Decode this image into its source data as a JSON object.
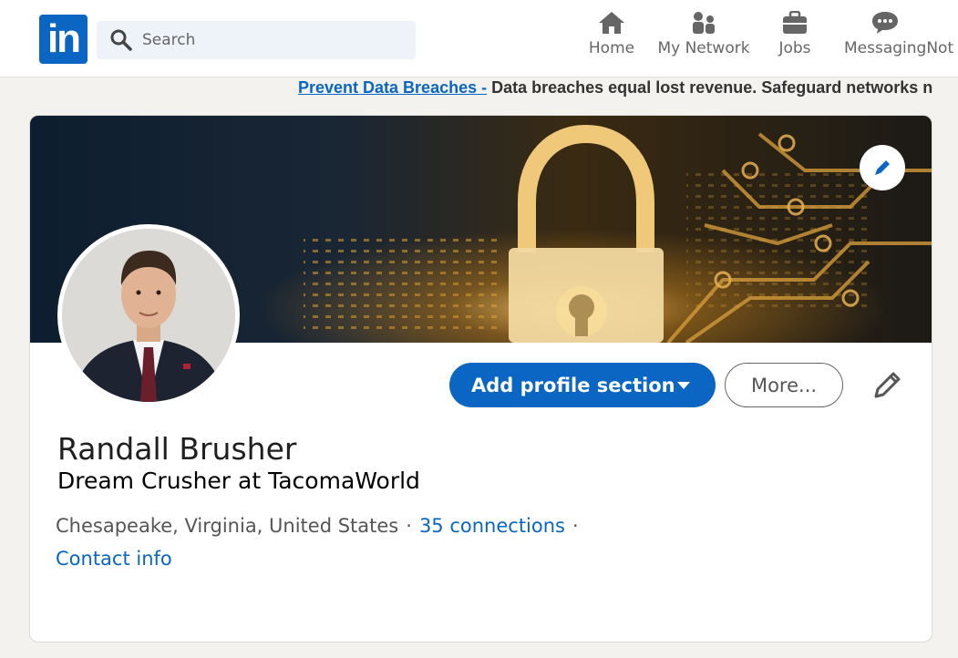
{
  "brand": {
    "logo_text": "in",
    "color": "#0a66c2"
  },
  "search": {
    "placeholder": "Search",
    "value": ""
  },
  "nav": {
    "items": [
      {
        "label": "Home",
        "icon": "home-icon"
      },
      {
        "label": "My Network",
        "icon": "network-icon"
      },
      {
        "label": "Jobs",
        "icon": "briefcase-icon"
      },
      {
        "label": "Messaging",
        "icon": "messaging-icon"
      },
      {
        "label": "Not",
        "icon": ""
      }
    ]
  },
  "ad": {
    "link": "Prevent Data Breaches -",
    "text": " Data breaches equal lost revenue. Safeguard networks n"
  },
  "profile": {
    "name": "Randall Brusher",
    "headline": "Dream Crusher at TacomaWorld",
    "location": "Chesapeake, Virginia, United States",
    "separator": "·",
    "connections": "35 connections",
    "contact": "Contact info"
  },
  "actions": {
    "add_section": "Add profile section",
    "more": "More..."
  },
  "colors": {
    "accent": "#0a66c2",
    "background": "#f3f2ef"
  }
}
